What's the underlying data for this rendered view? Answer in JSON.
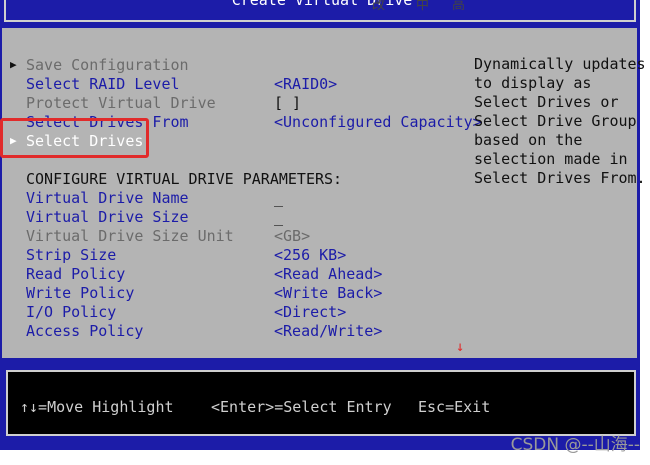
{
  "window": {
    "title": "Create Virtual Drive",
    "fragment_1": "改",
    "fragment_2": "中",
    "fragment_3": "高"
  },
  "menu": {
    "save_configuration": "Save Configuration",
    "select_raid_level": "Select RAID Level",
    "select_raid_level_value": "<RAID0>",
    "protect_virtual_drive": "Protect Virtual Drive",
    "protect_virtual_drive_value": "[ ]",
    "select_drives_from": "Select Drives From",
    "select_drives_from_value": "<Unconfigured Capacity>",
    "select_drives": "Select Drives",
    "section_header": "CONFIGURE VIRTUAL DRIVE PARAMETERS:",
    "virtual_drive_name": "Virtual Drive Name",
    "virtual_drive_name_value": "_",
    "virtual_drive_size": "Virtual Drive Size",
    "virtual_drive_size_value": "_",
    "virtual_drive_size_unit": "Virtual Drive Size Unit",
    "virtual_drive_size_unit_value": "<GB>",
    "strip_size": "Strip Size",
    "strip_size_value": "<256 KB>",
    "read_policy": "Read Policy",
    "read_policy_value": "<Read Ahead>",
    "write_policy": "Write Policy",
    "write_policy_value": "<Write Back>",
    "io_policy": "I/O Policy",
    "io_policy_value": "<Direct>",
    "access_policy": "Access Policy",
    "access_policy_value": "<Read/Write>"
  },
  "help": [
    "Dynamically updates",
    "to display as",
    "Select Drives or",
    "Select Drive Group",
    "based on the",
    "selection made in",
    "Select Drives From."
  ],
  "status": {
    "move": "↑↓=Move Highlight",
    "enter": "<Enter>=Select Entry",
    "esc": "Esc=Exit"
  },
  "watermark": "CSDN @--山海--",
  "colors": {
    "bios_blue": "#1c1ca8",
    "panel_gray": "#b4b4b4",
    "highlight_red": "#e12b2b"
  }
}
